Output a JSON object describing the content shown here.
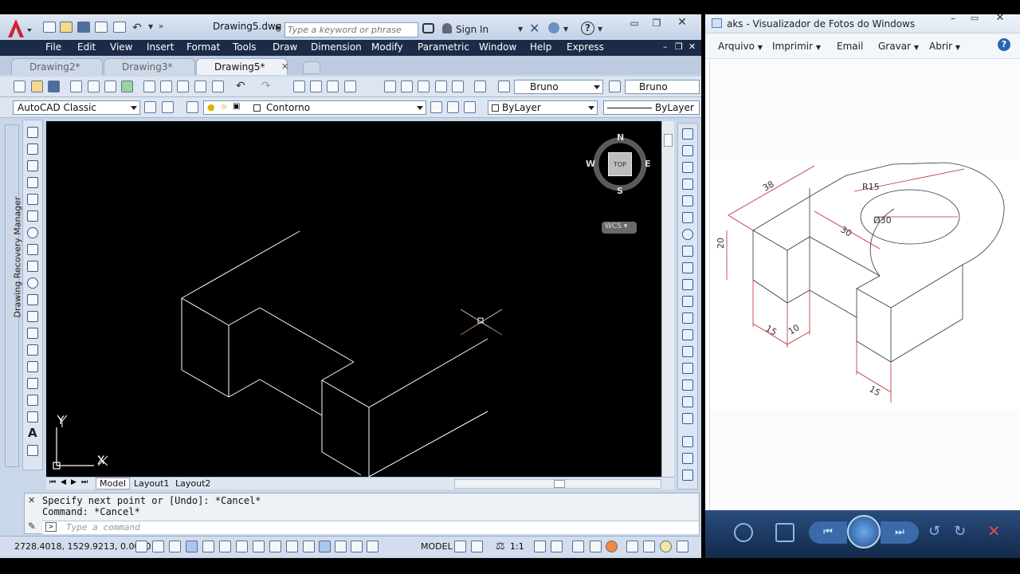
{
  "autocad": {
    "document_title": "Drawing5.dwg",
    "search_placeholder": "Type a keyword or phrase",
    "sign_in_label": "Sign In",
    "menus": [
      "File",
      "Edit",
      "View",
      "Insert",
      "Format",
      "Tools",
      "Draw",
      "Dimension",
      "Modify",
      "Parametric",
      "Window",
      "Help",
      "Express"
    ],
    "tabs": [
      {
        "label": "Drawing2*",
        "active": false
      },
      {
        "label": "Drawing3*",
        "active": false
      },
      {
        "label": "Drawing5*",
        "active": true
      }
    ],
    "text_style_value": "Bruno",
    "dim_style_value": "Bruno",
    "workspace_value": "AutoCAD Classic",
    "layer_value": "Contorno",
    "color_value": "ByLayer",
    "linetype_value": "ByLayer",
    "viewcube": {
      "north": "N",
      "south": "S",
      "east": "E",
      "west": "W",
      "face": "TOP",
      "wcs": "WCS"
    },
    "ucs": {
      "y": "Y",
      "x": "X"
    },
    "recovery_manager_label": "Drawing Recovery Manager",
    "layout_tabs": [
      "Model",
      "Layout1",
      "Layout2"
    ],
    "command_history": [
      "Specify next point or [Undo]: *Cancel*",
      "Command: *Cancel*"
    ],
    "command_placeholder": "Type a command",
    "coordinates": "2728.4018, 1529.9213, 0.0000",
    "model_label": "MODEL",
    "annotation_scale": "1:1"
  },
  "viewer": {
    "title": "aks - Visualizador de Fotos do Windows",
    "menus": [
      "Arquivo",
      "Imprimir",
      "Email",
      "Gravar",
      "Abrir"
    ],
    "drawing_dimensions": [
      "38",
      "R15",
      "Ø30",
      "30",
      "20",
      "15",
      "10",
      "15"
    ],
    "accent_color": "#c0282d"
  }
}
